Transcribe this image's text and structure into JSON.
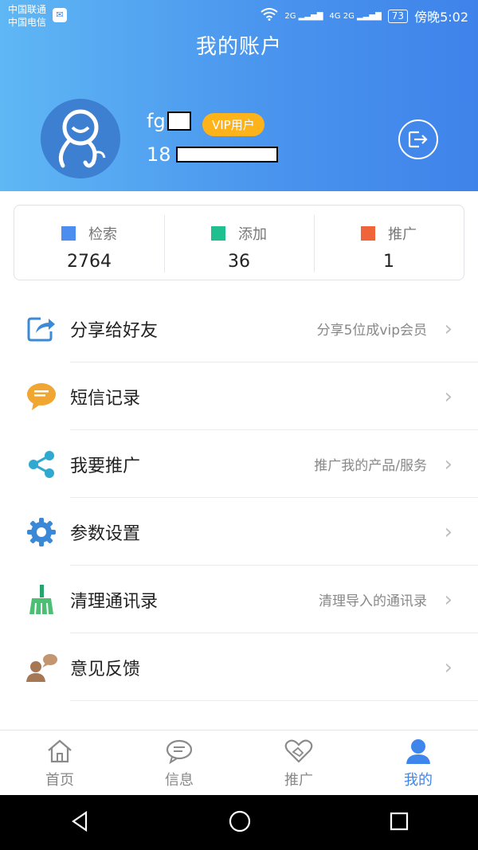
{
  "status_bar": {
    "carrier_line1": "中国联通",
    "carrier_line2": "中国电信",
    "signal1": "2G",
    "signal2": "4G 2G",
    "battery": "73",
    "time": "傍晚5:02"
  },
  "header": {
    "title": "我的账户",
    "username_visible": "fg",
    "vip_badge": "VIP用户",
    "phone_visible": "18"
  },
  "stats": [
    {
      "label": "检索",
      "value": "2764",
      "color": "#4c8ef0"
    },
    {
      "label": "添加",
      "value": "36",
      "color": "#1fbf8f"
    },
    {
      "label": "推广",
      "value": "1",
      "color": "#f0643a"
    }
  ],
  "menu": [
    {
      "label": "分享给好友",
      "hint": "分享5位成vip会员",
      "icon": "share-icon"
    },
    {
      "label": "短信记录",
      "hint": "",
      "icon": "message-bubble-icon"
    },
    {
      "label": "我要推广",
      "hint": "推广我的产品/服务",
      "icon": "share-nodes-icon"
    },
    {
      "label": "参数设置",
      "hint": "",
      "icon": "gear-icon"
    },
    {
      "label": "清理通讯录",
      "hint": "清理导入的通讯录",
      "icon": "broom-icon"
    },
    {
      "label": "意见反馈",
      "hint": "",
      "icon": "feedback-person-icon"
    }
  ],
  "bottom_nav": [
    {
      "label": "首页",
      "icon": "home-icon",
      "active": false
    },
    {
      "label": "信息",
      "icon": "chat-icon",
      "active": false
    },
    {
      "label": "推广",
      "icon": "handshake-heart-icon",
      "active": false
    },
    {
      "label": "我的",
      "icon": "user-icon",
      "active": true
    }
  ],
  "colors": {
    "accent": "#3f86ec",
    "vip": "#ffb31a"
  }
}
